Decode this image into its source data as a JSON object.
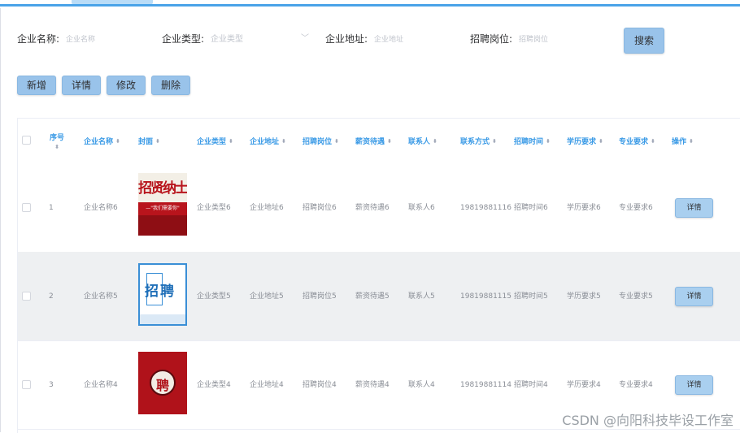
{
  "search": {
    "company_name_label": "企业名称:",
    "company_name_placeholder": "企业名称",
    "company_type_label": "企业类型:",
    "company_type_placeholder": "企业类型",
    "company_address_label": "企业地址:",
    "company_address_placeholder": "企业地址",
    "position_label": "招聘岗位:",
    "position_placeholder": "招聘岗位",
    "search_button": "搜索"
  },
  "toolbar": {
    "add": "新增",
    "detail": "详情",
    "edit": "修改",
    "delete": "删除"
  },
  "table": {
    "headers": {
      "index": "序号",
      "company_name": "企业名称",
      "cover": "封面",
      "company_type": "企业类型",
      "company_address": "企业地址",
      "position": "招聘岗位",
      "salary": "薪资待遇",
      "contact": "联系人",
      "phone": "联系方式",
      "time": "招聘时间",
      "education": "学历要求",
      "major": "专业要求",
      "action": "操作"
    },
    "rows": [
      {
        "index": "1",
        "company_name": "企业名称6",
        "cover_text": "招贤纳士",
        "cover_sub": "—\"我们需要你\"",
        "company_type": "企业类型6",
        "company_address": "企业地址6",
        "position": "招聘岗位6",
        "salary": "薪资待遇6",
        "contact": "联系人6",
        "phone": "19819881116",
        "time": "招聘时间6",
        "education": "学历要求6",
        "major": "专业要求6",
        "action": "详情"
      },
      {
        "index": "2",
        "company_name": "企业名称5",
        "cover_text": "招聘",
        "company_type": "企业类型5",
        "company_address": "企业地址5",
        "position": "招聘岗位5",
        "salary": "薪资待遇5",
        "contact": "联系人5",
        "phone": "19819881115",
        "time": "招聘时间5",
        "education": "学历要求5",
        "major": "专业要求5",
        "action": "详情"
      },
      {
        "index": "3",
        "company_name": "企业名称4",
        "cover_text": "聘",
        "company_type": "企业类型4",
        "company_address": "企业地址4",
        "position": "招聘岗位4",
        "salary": "薪资待遇4",
        "contact": "联系人4",
        "phone": "19819881114",
        "time": "招聘时间4",
        "education": "学历要求4",
        "major": "专业要求4",
        "action": "详情"
      }
    ]
  },
  "watermark": "CSDN @向阳科技毕设工作室",
  "colors": {
    "accent": "#4aa3e8",
    "header_text": "#3a9ae6",
    "button_bg": "#99c3ea"
  }
}
